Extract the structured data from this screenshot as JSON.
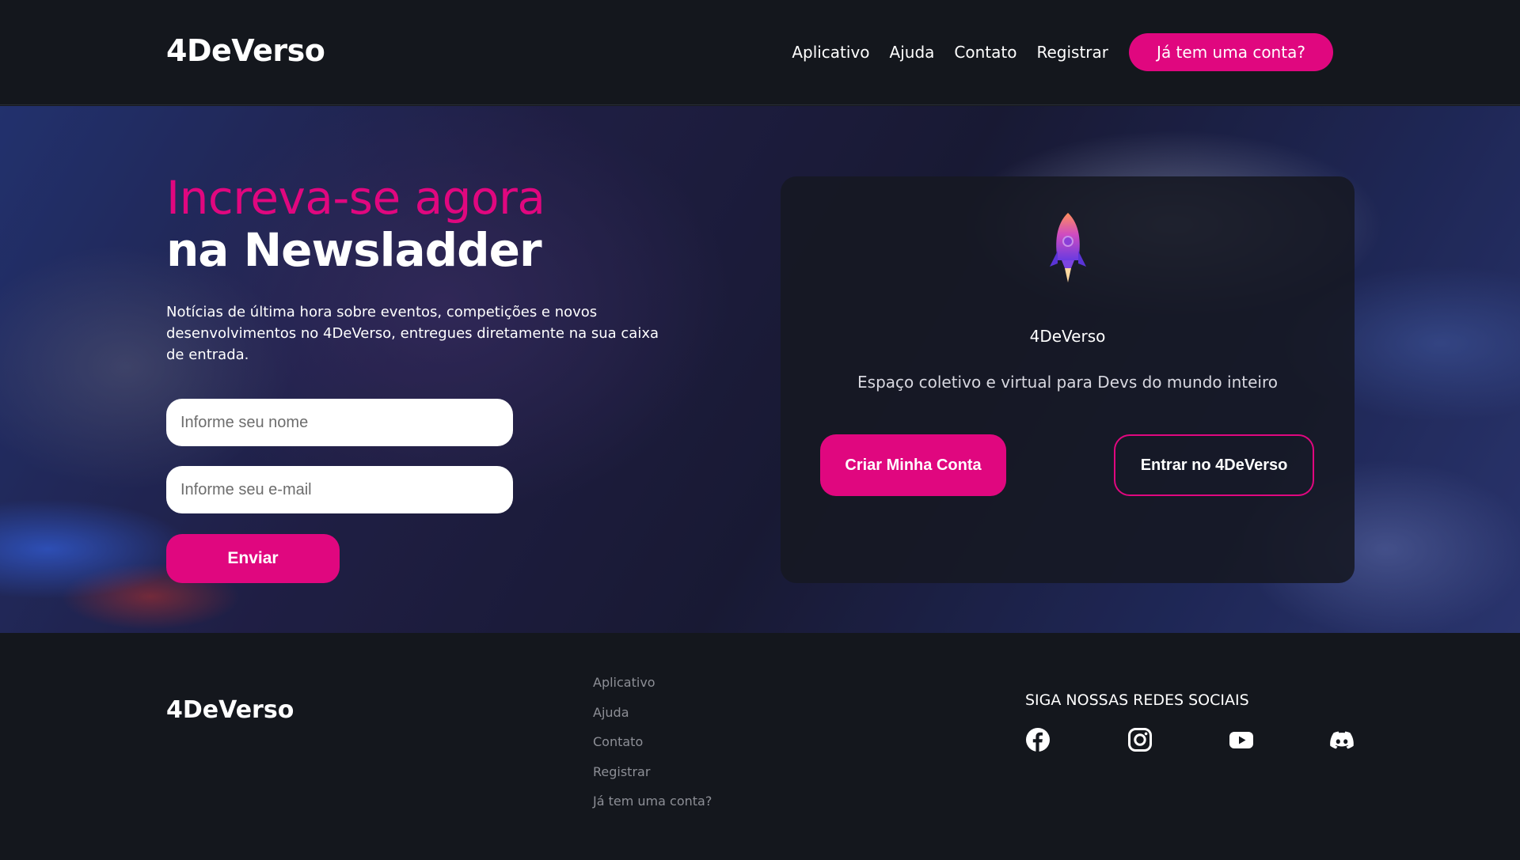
{
  "header": {
    "logo": "4DeVerso",
    "nav": [
      "Aplicativo",
      "Ajuda",
      "Contato",
      "Registrar"
    ],
    "login_button": "Já tem uma conta?"
  },
  "hero": {
    "headline_pink": "Increva-se agora",
    "headline_white": "na Newsladder",
    "description": "Notícias de última hora sobre eventos, competições e novos desenvolvimentos no 4DeVerso, entregues diretamente na sua caixa de entrada.",
    "name_placeholder": "Informe seu nome",
    "email_placeholder": "Informe seu e-mail",
    "send_button": "Enviar"
  },
  "card": {
    "icon": "rocket-icon",
    "title": "4DeVerso",
    "subtitle": "Espaço coletivo e virtual para Devs do mundo inteiro",
    "create_button": "Criar Minha Conta",
    "enter_button": "Entrar no 4DeVerso"
  },
  "footer": {
    "logo": "4DeVerso",
    "links": [
      "Aplicativo",
      "Ajuda",
      "Contato",
      "Registrar",
      "Já tem uma conta?"
    ],
    "social_title": "SIGA NOSSAS REDES SOCIAIS",
    "social_icons": [
      "facebook-icon",
      "instagram-icon",
      "youtube-icon",
      "discord-icon"
    ]
  },
  "colors": {
    "accent": "#e0077f",
    "background": "#14171d",
    "footer_link": "#8d8f96"
  }
}
